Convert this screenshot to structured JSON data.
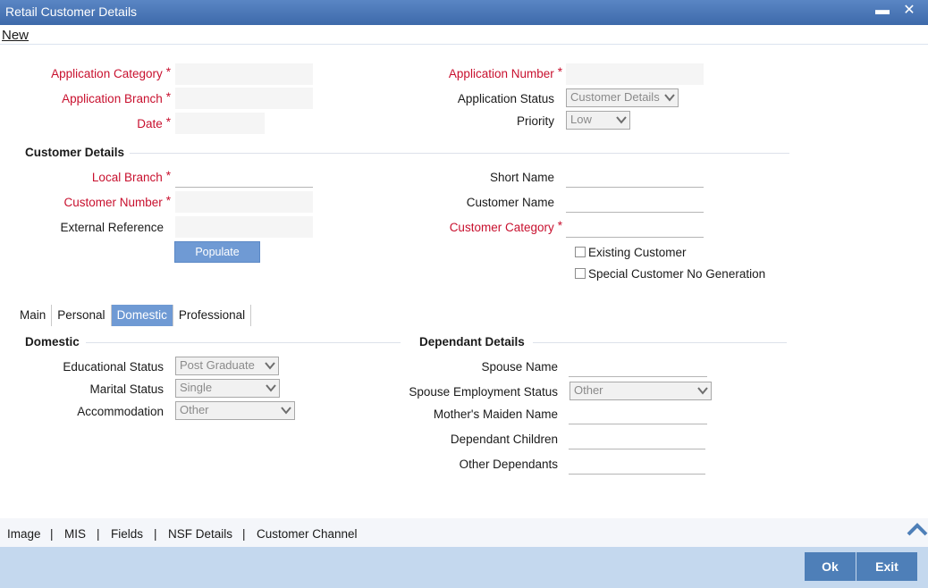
{
  "window": {
    "title": "Retail Customer Details",
    "minimize_glyph": "▬",
    "close_glyph": "✕"
  },
  "toolbar": {
    "new_label": "New"
  },
  "header": {
    "application_category": "Application Category",
    "application_branch": "Application Branch",
    "date": "Date",
    "application_number": "Application Number",
    "application_status": "Application Status",
    "application_status_value": "Customer Details",
    "priority": "Priority",
    "priority_value": "Low",
    "required_mark": "*"
  },
  "customer_details": {
    "section_title": "Customer Details",
    "local_branch": "Local Branch",
    "customer_number": "Customer Number",
    "external_reference": "External Reference",
    "short_name": "Short Name",
    "customer_name": "Customer Name",
    "customer_category": "Customer Category",
    "populate_label": "Populate",
    "existing_customer": "Existing Customer",
    "special_customer": "Special Customer No Generation"
  },
  "tabs": [
    {
      "label": "Main"
    },
    {
      "label": "Personal"
    },
    {
      "label": "Domestic"
    },
    {
      "label": "Professional"
    }
  ],
  "domestic": {
    "section_title": "Domestic",
    "educational_status": "Educational Status",
    "educational_status_value": "Post Graduate",
    "marital_status": "Marital Status",
    "marital_status_value": "Single",
    "accommodation": "Accommodation",
    "accommodation_value": "Other"
  },
  "dependant": {
    "section_title": "Dependant Details",
    "spouse_name": "Spouse Name",
    "spouse_employment_status": "Spouse Employment Status",
    "spouse_employment_value": "Other",
    "mothers_maiden_name": "Mother's Maiden Name",
    "dependant_children": "Dependant Children",
    "other_dependants": "Other Dependants"
  },
  "footer": {
    "links": [
      "Image",
      "MIS",
      "Fields",
      "NSF Details",
      "Customer Channel"
    ],
    "separator": "|",
    "ok_label": "Ok",
    "exit_label": "Exit"
  },
  "colors": {
    "title_bar": "#4a77b8",
    "required": "#c8102e",
    "active_tab": "#6f9ad4",
    "bottom_bar": "#c4d8ee",
    "action_button": "#4e7fb8"
  }
}
